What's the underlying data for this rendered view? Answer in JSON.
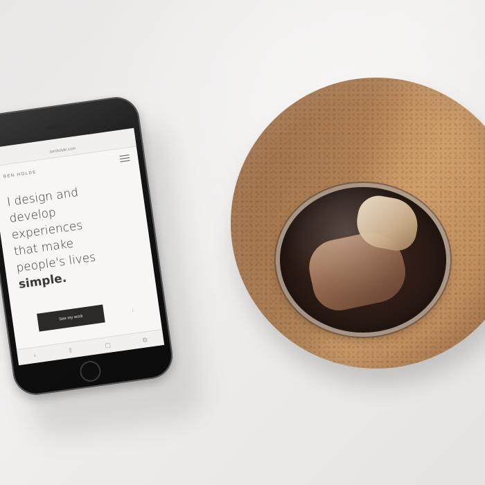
{
  "phone": {
    "site_url": "benholde.com",
    "brand": "BEN HOLDE",
    "headline_lines": [
      "I design and",
      "develop",
      "experiences",
      "that make",
      "people's lives"
    ],
    "headline_emphasis": "simple.",
    "cta_label": "See my work",
    "scroll_arrow": "↓",
    "toolbar_icons": [
      "‹",
      "⇪",
      "▢",
      "⧉"
    ]
  }
}
